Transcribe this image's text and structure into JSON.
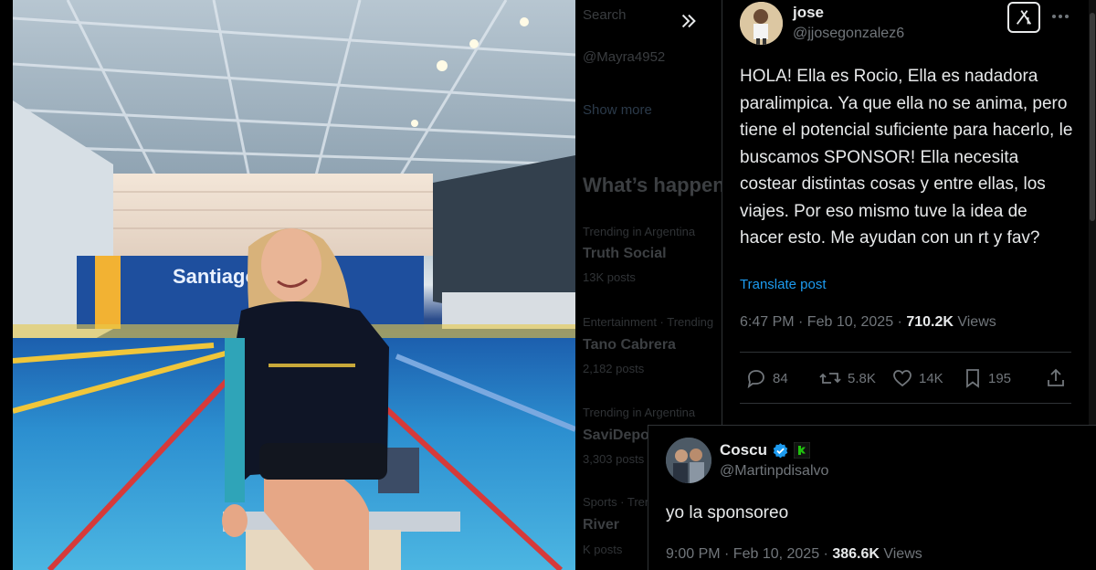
{
  "background_timeline": {
    "search_placeholder": "Search",
    "handle_snippet": "@Mayra4952",
    "show_more": "Show more",
    "section_title": "What’s happen",
    "trends": [
      {
        "context": "Trending in Argentina",
        "name": "Truth Social",
        "posts": "13K posts"
      },
      {
        "context": "Entertainment · Trending",
        "name": "Tano Cabrera",
        "posts": "2,182 posts"
      },
      {
        "context": "Trending in Argentina",
        "name": "SaviDepo",
        "posts": "3,303 posts"
      },
      {
        "context": "Sports · Trending",
        "name": "River",
        "posts": "K posts"
      }
    ]
  },
  "tweet": {
    "author_name": "jose",
    "author_handle": "@jjosegonzalez6",
    "text": "HOLA! Ella es Rocio, Ella es nadadora paralimpica. Ya que ella no se anima, pero tiene el potencial suficiente para hacerlo, le buscamos SPONSOR! Ella necesita costear distintas cosas y entre ellas, los viajes. Por eso mismo tuve la idea de hacer esto. Me ayudan con un rt y fav?",
    "translate_label": "Translate post",
    "time": "6:47 PM · Feb 10, 2025 · ",
    "views_count": "710.2K",
    "views_label": " Views",
    "replies": "84",
    "reposts": "5.8K",
    "likes": "14K",
    "bookmarks": "195"
  },
  "reply": {
    "author_name": "Coscu",
    "author_handle": "@Martinpdisalvo",
    "text": "yo la sponsoreo",
    "time": "9:00 PM · Feb 10, 2025 · ",
    "views_count": "386.6K",
    "views_label": " Views"
  },
  "colors": {
    "accent": "#1d9bf0",
    "muted": "#71767b",
    "text": "#e7e9ea",
    "verified": "#1d9bf0",
    "affiliate_badge": "#20c20e"
  },
  "icons": [
    "expand-chevrons-icon",
    "grok-icon",
    "more-options-icon",
    "reply-icon",
    "repost-icon",
    "like-icon",
    "bookmark-icon",
    "share-icon",
    "verified-icon",
    "kick-affiliate-icon"
  ]
}
